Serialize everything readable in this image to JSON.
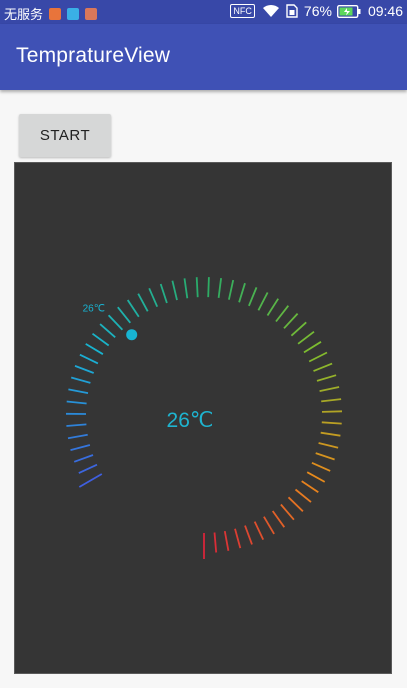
{
  "status_bar": {
    "carrier": "无服务",
    "nfc": "NFC",
    "battery_percent": "76%",
    "time": "09:46",
    "notification_icons": [
      "mail-notification-icon",
      "message-notification-icon",
      "app-notification-icon"
    ]
  },
  "app_bar": {
    "title": "TempratureView"
  },
  "controls": {
    "start_label": "START"
  },
  "gauge": {
    "center_label": "26℃",
    "indicator_label": "26℃",
    "value": 26,
    "min": 0,
    "max": 100,
    "tick_count": 60,
    "colors": {
      "panel_background": "#353535",
      "center_text": "#1eb4d0",
      "indicator_dot": "#18b4d2",
      "gradient_stops": [
        "#3f5fe0",
        "#18b4d2",
        "#2bab66",
        "#7fbd2e",
        "#e8891c",
        "#d8253a"
      ]
    }
  }
}
